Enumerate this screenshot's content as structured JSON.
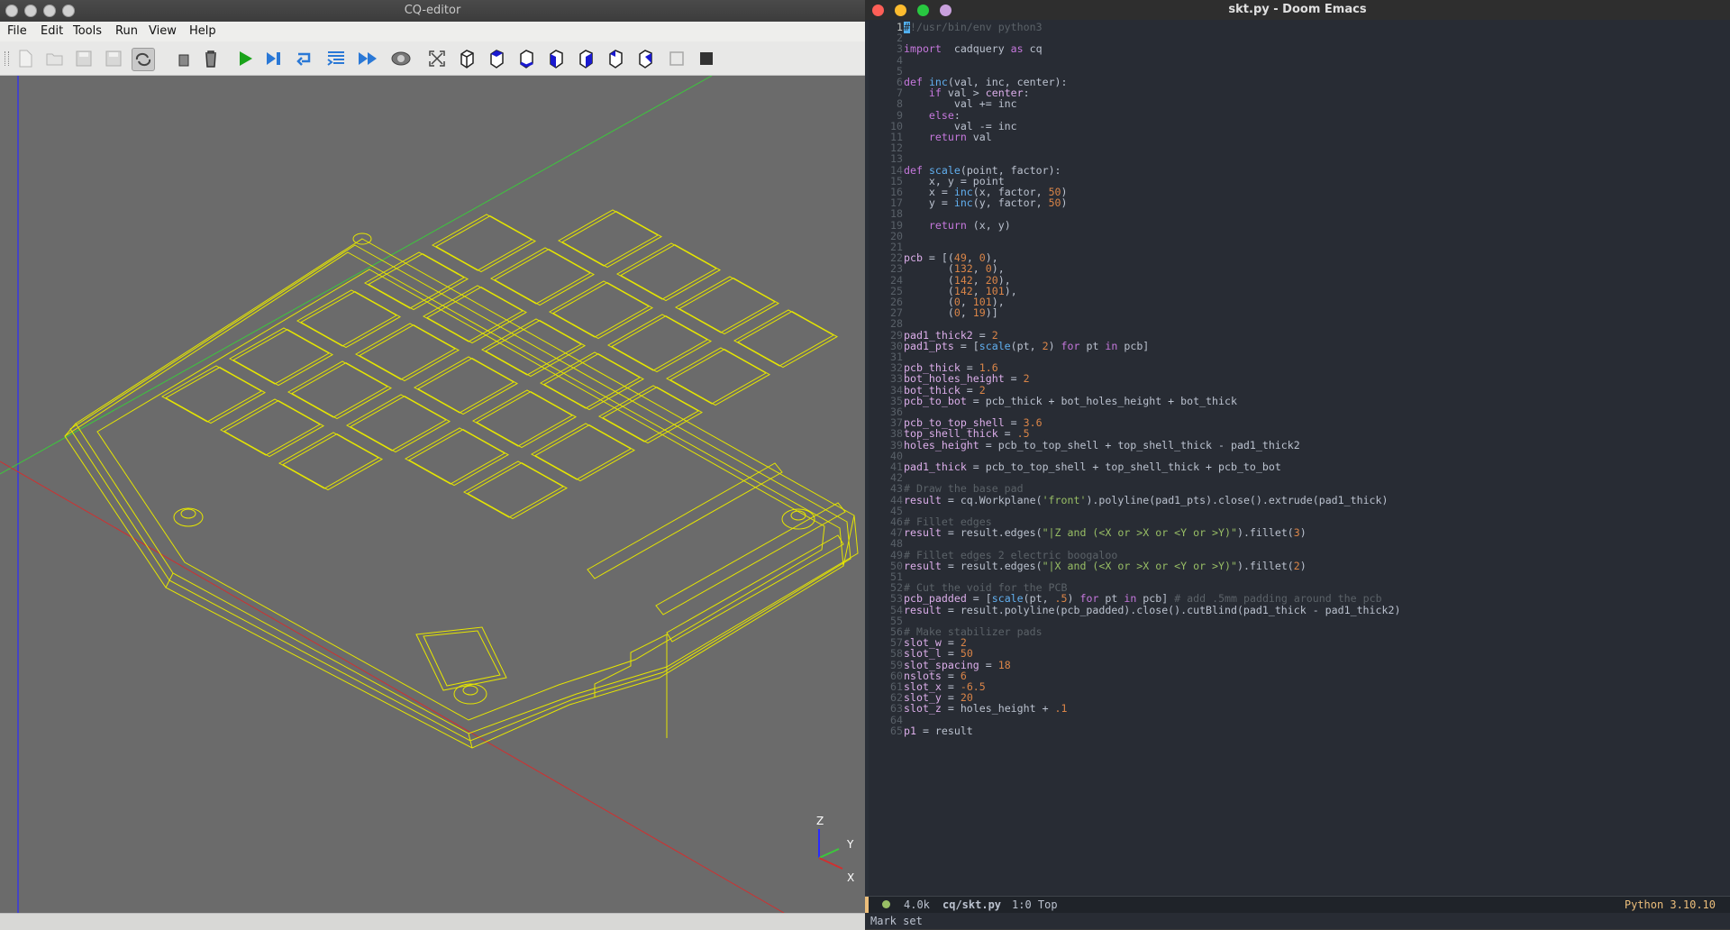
{
  "cq_editor": {
    "title": "CQ-editor",
    "menu": [
      "File",
      "Edit",
      "Tools",
      "Run",
      "View",
      "Help"
    ],
    "toolbar_icons": [
      "new-file-icon",
      "open-file-icon",
      "save-icon",
      "save-as-icon",
      "autoreload-icon",
      "copy-icon",
      "delete-icon",
      "run-icon",
      "step-icon",
      "debug-icon",
      "debug-step-icon",
      "continue-icon",
      "camera-icon",
      "fit-view-icon",
      "iso-view-icon",
      "top-view-icon",
      "bottom-view-icon",
      "front-view-icon",
      "back-view-icon",
      "left-view-icon",
      "right-view-icon",
      "wireframe-icon",
      "shaded-icon"
    ],
    "axis_labels": {
      "z": "Z",
      "y": "Y",
      "x": "X"
    },
    "colors": {
      "viewport_bg": "#6b6b6b",
      "wireframe": "#e6e600",
      "axis_x": "#d03030",
      "axis_y": "#3cc83c",
      "axis_z": "#2a2aff"
    }
  },
  "emacs": {
    "title": "skt.py - Doom Emacs",
    "code_lines": [
      [
        [
          "com",
          "#!/usr/bin/env python3"
        ]
      ],
      [],
      [
        [
          "kw",
          "import"
        ],
        [
          "",
          "  cadquery "
        ],
        [
          "kw",
          "as"
        ],
        [
          "",
          " cq"
        ]
      ],
      [],
      [],
      [
        [
          "kw",
          "def"
        ],
        [
          "",
          " "
        ],
        [
          "fn",
          "inc"
        ],
        [
          "",
          "(val, inc, center):"
        ]
      ],
      [
        [
          "",
          "    "
        ],
        [
          "kw",
          "if"
        ],
        [
          "",
          " val > "
        ],
        [
          "var",
          "center"
        ],
        [
          "",
          ":"
        ]
      ],
      [
        [
          "",
          "        val += inc"
        ]
      ],
      [
        [
          "",
          "    "
        ],
        [
          "kw",
          "else"
        ],
        [
          "",
          ":"
        ]
      ],
      [
        [
          "",
          "        val -= inc"
        ]
      ],
      [
        [
          "",
          "    "
        ],
        [
          "kw",
          "return"
        ],
        [
          "",
          " val"
        ]
      ],
      [],
      [],
      [
        [
          "kw",
          "def"
        ],
        [
          "",
          " "
        ],
        [
          "fn",
          "scale"
        ],
        [
          "",
          "(point, factor):"
        ]
      ],
      [
        [
          "",
          "    x, y = point"
        ]
      ],
      [
        [
          "",
          "    x = "
        ],
        [
          "fn",
          "inc"
        ],
        [
          "",
          "(x, factor, "
        ],
        [
          "num",
          "50"
        ],
        [
          "",
          ")"
        ]
      ],
      [
        [
          "",
          "    y = "
        ],
        [
          "fn",
          "inc"
        ],
        [
          "",
          "(y, factor, "
        ],
        [
          "num",
          "50"
        ],
        [
          "",
          ")"
        ]
      ],
      [],
      [
        [
          "",
          "    "
        ],
        [
          "kw",
          "return"
        ],
        [
          "",
          " (x, y)"
        ]
      ],
      [],
      [],
      [
        [
          "var",
          "pcb"
        ],
        [
          "",
          " = [("
        ],
        [
          "num",
          "49"
        ],
        [
          "",
          ", "
        ],
        [
          "num",
          "0"
        ],
        [
          "",
          "),"
        ]
      ],
      [
        [
          "",
          "       ("
        ],
        [
          "num",
          "132"
        ],
        [
          "",
          ", "
        ],
        [
          "num",
          "0"
        ],
        [
          "",
          "),"
        ]
      ],
      [
        [
          "",
          "       ("
        ],
        [
          "num",
          "142"
        ],
        [
          "",
          ", "
        ],
        [
          "num",
          "20"
        ],
        [
          "",
          "),"
        ]
      ],
      [
        [
          "",
          "       ("
        ],
        [
          "num",
          "142"
        ],
        [
          "",
          ", "
        ],
        [
          "num",
          "101"
        ],
        [
          "",
          "),"
        ]
      ],
      [
        [
          "",
          "       ("
        ],
        [
          "num",
          "0"
        ],
        [
          "",
          ", "
        ],
        [
          "num",
          "101"
        ],
        [
          "",
          "),"
        ]
      ],
      [
        [
          "",
          "       ("
        ],
        [
          "num",
          "0"
        ],
        [
          "",
          ", "
        ],
        [
          "num",
          "19"
        ],
        [
          "",
          ")]"
        ]
      ],
      [],
      [
        [
          "var",
          "pad1_thick2"
        ],
        [
          "",
          " = "
        ],
        [
          "num",
          "2"
        ]
      ],
      [
        [
          "var",
          "pad1_pts"
        ],
        [
          "",
          " = ["
        ],
        [
          "fn",
          "scale"
        ],
        [
          "",
          "(pt, "
        ],
        [
          "num",
          "2"
        ],
        [
          "",
          ") "
        ],
        [
          "kw",
          "for"
        ],
        [
          "",
          " pt "
        ],
        [
          "kw",
          "in"
        ],
        [
          "",
          " pcb]"
        ]
      ],
      [],
      [
        [
          "var",
          "pcb_thick"
        ],
        [
          "",
          " = "
        ],
        [
          "num",
          "1.6"
        ]
      ],
      [
        [
          "var",
          "bot_holes_height"
        ],
        [
          "",
          " = "
        ],
        [
          "num",
          "2"
        ]
      ],
      [
        [
          "var",
          "bot_thick"
        ],
        [
          "",
          " = "
        ],
        [
          "num",
          "2"
        ]
      ],
      [
        [
          "var",
          "pcb_to_bot"
        ],
        [
          "",
          " = pcb_thick + bot_holes_height + bot_thick"
        ]
      ],
      [],
      [
        [
          "var",
          "pcb_to_top_shell"
        ],
        [
          "",
          " = "
        ],
        [
          "num",
          "3.6"
        ]
      ],
      [
        [
          "var",
          "top_shell_thick"
        ],
        [
          "",
          " = "
        ],
        [
          "num",
          ".5"
        ]
      ],
      [
        [
          "var",
          "holes_height"
        ],
        [
          "",
          " = pcb_to_top_shell + top_shell_thick - pad1_thick2"
        ]
      ],
      [],
      [
        [
          "var",
          "pad1_thick"
        ],
        [
          "",
          " = pcb_to_top_shell + top_shell_thick + pcb_to_bot"
        ]
      ],
      [],
      [
        [
          "com",
          "# Draw the base pad"
        ]
      ],
      [
        [
          "var",
          "result"
        ],
        [
          "",
          " = cq.Workplane("
        ],
        [
          "str",
          "'front'"
        ],
        [
          "",
          ").polyline(pad1_pts).close().extrude(pad1_thick)"
        ]
      ],
      [],
      [
        [
          "com",
          "# Fillet edges"
        ]
      ],
      [
        [
          "var",
          "result"
        ],
        [
          "",
          " = result.edges("
        ],
        [
          "str",
          "\"|Z and (<X or >X or <Y or >Y)\""
        ],
        [
          "",
          ").fillet("
        ],
        [
          "num",
          "3"
        ],
        [
          "",
          ")"
        ]
      ],
      [],
      [
        [
          "com",
          "# Fillet edges 2 electric boogaloo"
        ]
      ],
      [
        [
          "var",
          "result"
        ],
        [
          "",
          " = result.edges("
        ],
        [
          "str",
          "\"|X and (<X or >X or <Y or >Y)\""
        ],
        [
          "",
          ").fillet("
        ],
        [
          "num",
          "2"
        ],
        [
          "",
          ")"
        ]
      ],
      [],
      [
        [
          "com",
          "# Cut the void for the PCB"
        ]
      ],
      [
        [
          "var",
          "pcb_padded"
        ],
        [
          "",
          " = ["
        ],
        [
          "fn",
          "scale"
        ],
        [
          "",
          "(pt, "
        ],
        [
          "num",
          ".5"
        ],
        [
          "",
          ") "
        ],
        [
          "kw",
          "for"
        ],
        [
          "",
          " pt "
        ],
        [
          "kw",
          "in"
        ],
        [
          "",
          " pcb] "
        ],
        [
          "com",
          "# add .5mm padding around the pcb"
        ]
      ],
      [
        [
          "var",
          "result"
        ],
        [
          "",
          " = result.polyline(pcb_padded).close().cutBlind(pad1_thick - pad1_thick2)"
        ]
      ],
      [],
      [
        [
          "com",
          "# Make stabilizer pads"
        ]
      ],
      [
        [
          "var",
          "slot_w"
        ],
        [
          "",
          " = "
        ],
        [
          "num",
          "2"
        ]
      ],
      [
        [
          "var",
          "slot_l"
        ],
        [
          "",
          " = "
        ],
        [
          "num",
          "50"
        ]
      ],
      [
        [
          "var",
          "slot_spacing"
        ],
        [
          "",
          " = "
        ],
        [
          "num",
          "18"
        ]
      ],
      [
        [
          "var",
          "nslots"
        ],
        [
          "",
          " = "
        ],
        [
          "num",
          "6"
        ]
      ],
      [
        [
          "var",
          "slot_x"
        ],
        [
          "",
          " = "
        ],
        [
          "num",
          "-6.5"
        ]
      ],
      [
        [
          "var",
          "slot_y"
        ],
        [
          "",
          " = "
        ],
        [
          "num",
          "20"
        ]
      ],
      [
        [
          "var",
          "slot_z"
        ],
        [
          "",
          " = holes_height + "
        ],
        [
          "num",
          ".1"
        ]
      ],
      [],
      [
        [
          "var",
          "p1"
        ],
        [
          "",
          " = result"
        ]
      ]
    ],
    "modeline": {
      "size": "4.0k",
      "file": "cq/skt.py",
      "position": "1:0 Top",
      "mode": "Python 3.10.10"
    },
    "echo": "Mark set"
  }
}
